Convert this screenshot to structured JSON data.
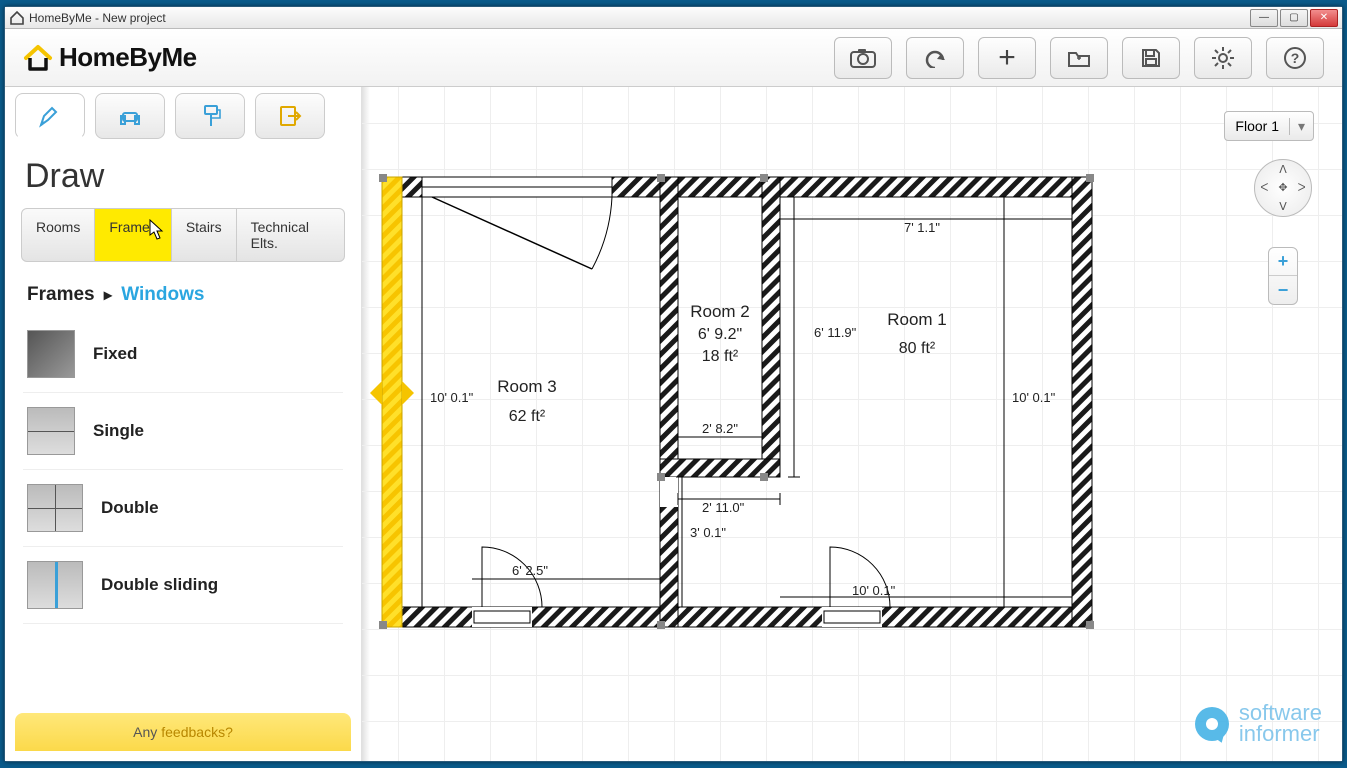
{
  "window": {
    "title": "HomeByMe - New project"
  },
  "brand": {
    "name": "HomeByMe"
  },
  "toolbar_icons": [
    "camera",
    "undo",
    "add",
    "open",
    "save",
    "settings",
    "help"
  ],
  "sidebar": {
    "section_title": "Draw",
    "tooltabs": [
      "draw",
      "furnish",
      "decorate",
      "export"
    ],
    "active_tooltab": 0,
    "subtabs": [
      "Rooms",
      "Frames",
      "Stairs",
      "Technical Elts."
    ],
    "active_subtab": 1,
    "breadcrumb": {
      "category": "Frames",
      "current": "Windows"
    },
    "items": [
      {
        "id": "fixed",
        "label": "Fixed"
      },
      {
        "id": "single",
        "label": "Single"
      },
      {
        "id": "double",
        "label": "Double"
      },
      {
        "id": "double-sliding",
        "label": "Double sliding"
      }
    ],
    "feedback_prefix": "Any",
    "feedback_link": "feedbacks?"
  },
  "floor_selector": {
    "label": "Floor 1"
  },
  "rooms": {
    "r1": {
      "name": "Room 1",
      "area": "80 ft²"
    },
    "r2": {
      "name": "Room 2",
      "width": "6' 9.2\"",
      "area": "18 ft²"
    },
    "r3": {
      "name": "Room 3",
      "area": "62 ft²"
    }
  },
  "dimensions": {
    "d1": "7' 1.1\"",
    "d2": "6' 11.9\"",
    "d3": "10' 0.1\"",
    "d4": "10' 0.1\"",
    "d5": "2' 8.2\"",
    "d6": "2' 11.0\"",
    "d7": "3' 0.1\"",
    "d8": "6' 2.5\"",
    "d9": "10' 0.1\""
  },
  "watermark": {
    "line1": "software",
    "line2": "informer"
  }
}
